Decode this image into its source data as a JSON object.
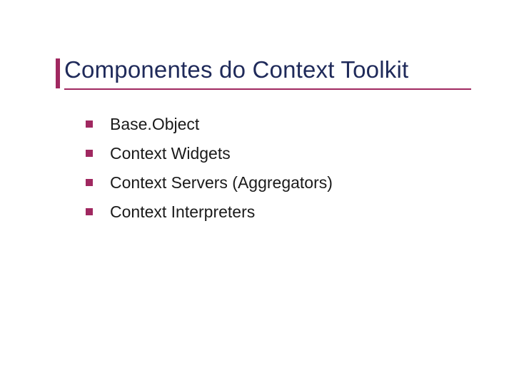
{
  "slide": {
    "title": "Componentes do Context Toolkit",
    "bullets": [
      "Base.Object",
      "Context Widgets",
      "Context Servers (Aggregators)",
      "Context Interpreters"
    ]
  }
}
